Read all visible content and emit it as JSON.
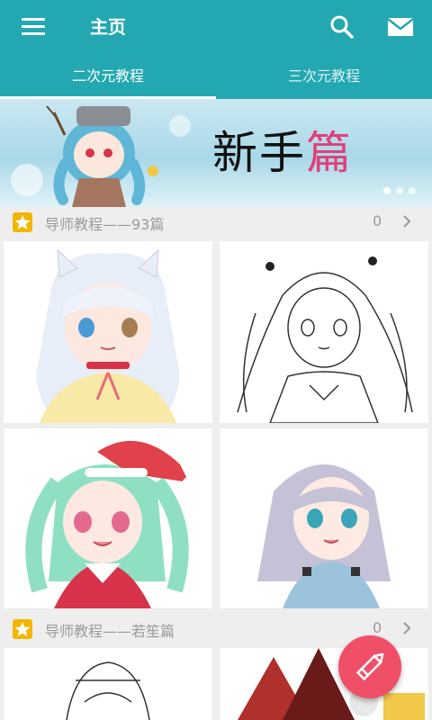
{
  "header": {
    "title": "主页",
    "background_color": "#23a8b1",
    "icons": [
      "menu-icon",
      "search-icon",
      "mail-icon"
    ]
  },
  "tabs": [
    {
      "label": "二次元教程",
      "active": true
    },
    {
      "label": "三次元教程",
      "active": false
    }
  ],
  "banner": {
    "text_dark": "新手",
    "text_pink": "篇",
    "pink_color": "#e0407a",
    "pages": 3,
    "active_page": 1
  },
  "sections": [
    {
      "title": "导师教程——93篇",
      "count": "0"
    },
    {
      "title": "导师教程——若笙篇",
      "count": "0"
    }
  ],
  "fab": {
    "icon": "pencil-icon",
    "color": "#ef5068"
  }
}
